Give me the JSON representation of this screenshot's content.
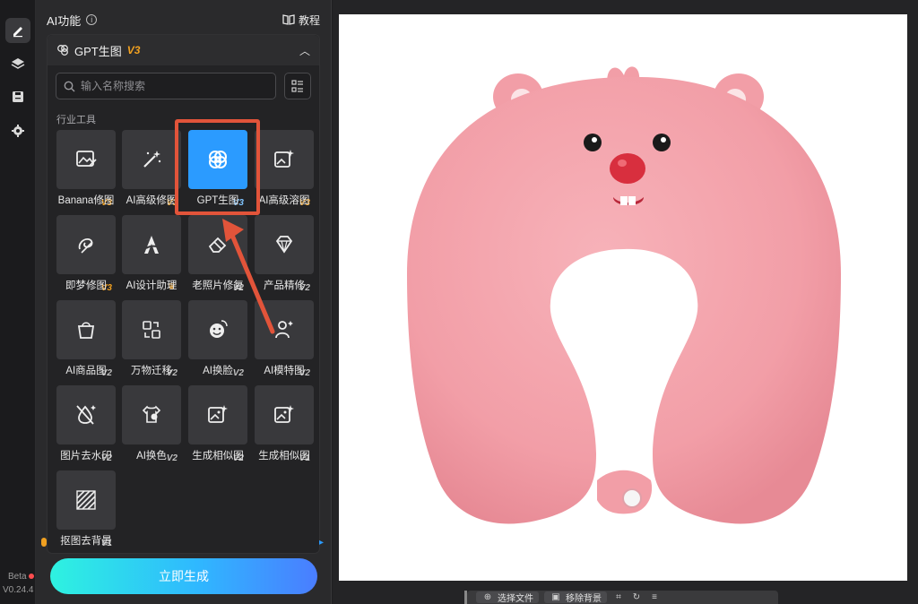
{
  "rail": {
    "version_beta": "Beta",
    "version": "V0.24.4"
  },
  "panel": {
    "title": "AI功能",
    "tutorial": "教程",
    "card_title": "GPT生图",
    "card_version": "V3",
    "search_placeholder": "输入名称搜索",
    "section_label": "行业工具",
    "tools": [
      {
        "label": "Banana修图",
        "version": "V3",
        "icon": "image-edit-icon"
      },
      {
        "label": "AI高级修图",
        "version": "V3",
        "icon": "magic-wand-icon"
      },
      {
        "label": "GPT生图",
        "version": "V3",
        "icon": "gpt-knot-icon",
        "selected": true
      },
      {
        "label": "AI高级溶图",
        "version": "V3",
        "icon": "image-sparkle-icon"
      },
      {
        "label": "即梦修图",
        "version": "V3",
        "icon": "dream-retouch-icon"
      },
      {
        "label": "AI设计助理",
        "version": "",
        "icon": "design-assistant-icon"
      },
      {
        "label": "老照片修复",
        "version": "V2",
        "icon": "eraser-icon"
      },
      {
        "label": "产品精修",
        "version": "V2",
        "icon": "diamond-icon"
      },
      {
        "label": "AI商品图",
        "version": "V2",
        "icon": "shopping-bag-icon"
      },
      {
        "label": "万物迁移",
        "version": "V2",
        "icon": "transfer-icon"
      },
      {
        "label": "AI换脸",
        "version": "V2",
        "icon": "face-swap-icon"
      },
      {
        "label": "AI模特图",
        "version": "V2",
        "icon": "model-icon"
      },
      {
        "label": "图片去水印",
        "version": "V2",
        "icon": "remove-watermark-icon"
      },
      {
        "label": "AI换色",
        "version": "V2",
        "icon": "tshirt-palette-icon"
      },
      {
        "label": "生成相似图",
        "version": "V2",
        "icon": "similar-image-icon"
      },
      {
        "label": "生成相似图",
        "version": "V1",
        "icon": "similar-image-v1-icon"
      },
      {
        "label": "抠图去背景",
        "version": "V1",
        "icon": "cutout-icon"
      }
    ]
  },
  "generate_button": "立即生成",
  "toolbar": {
    "choose_file": "选择文件",
    "remove_bg": "移除背景"
  },
  "colors": {
    "accent": "#2b9bff",
    "version_badge": "#f0a020",
    "highlight": "#e2543a",
    "pillow_pink": "#f4a3ab"
  }
}
